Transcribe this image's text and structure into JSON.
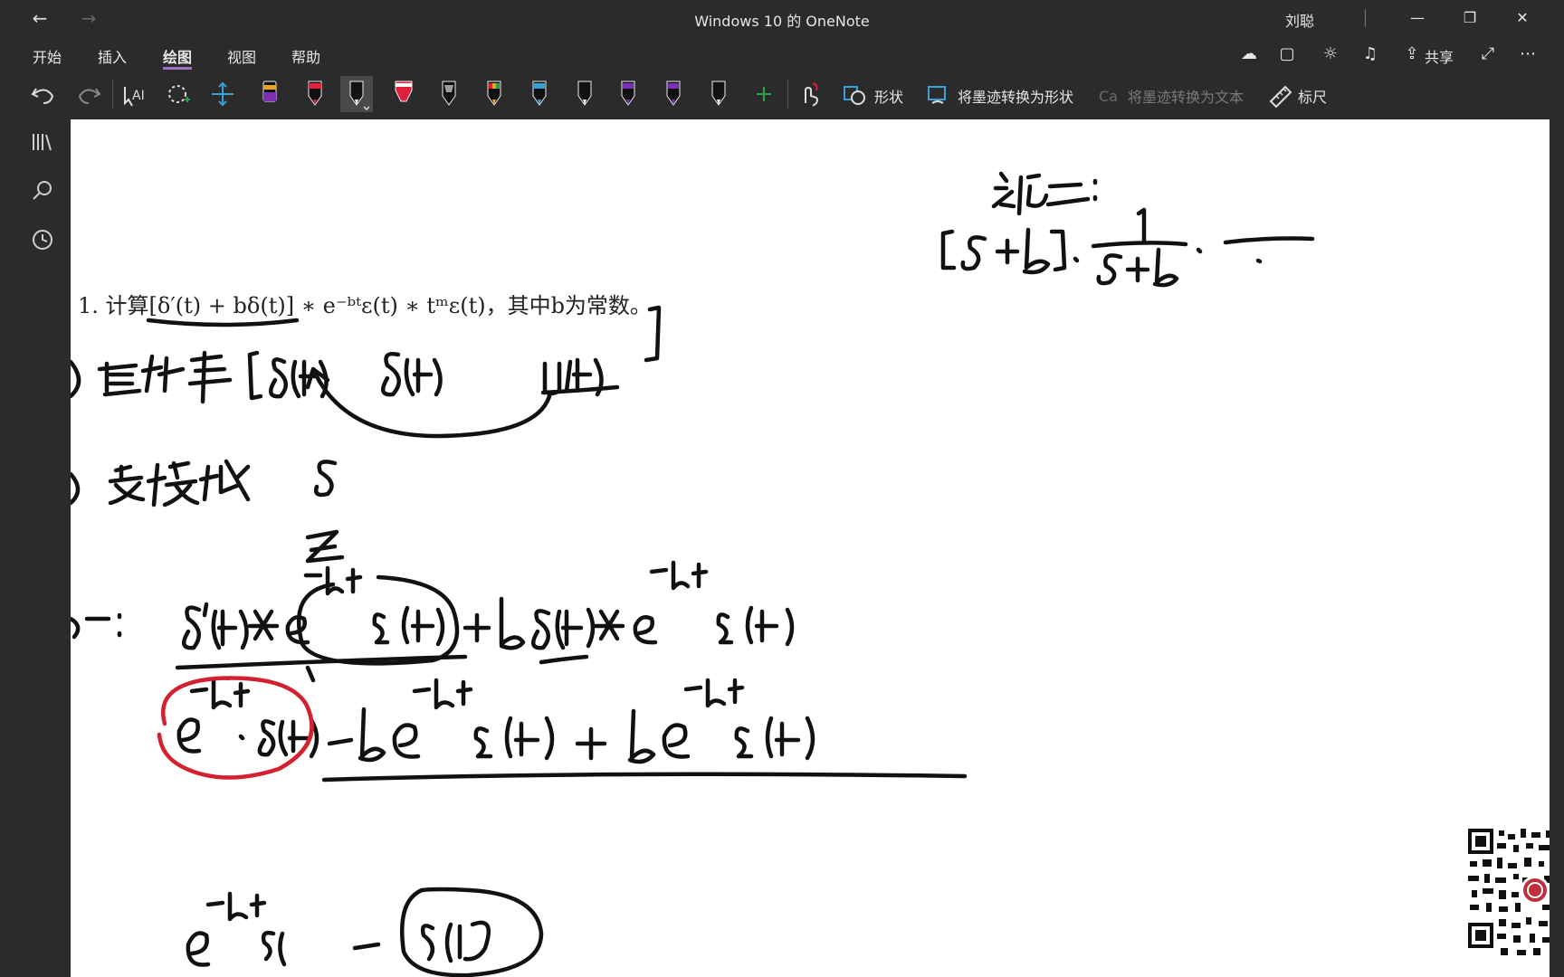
{
  "window": {
    "title": "Windows 10 的 OneNote",
    "user": "刘聪"
  },
  "menu": {
    "tabs": [
      {
        "label": "开始"
      },
      {
        "label": "插入"
      },
      {
        "label": "绘图"
      },
      {
        "label": "视图"
      },
      {
        "label": "帮助"
      }
    ],
    "active_tab": "绘图",
    "share_label": "共享"
  },
  "ribbon": {
    "shapes_label": "形状",
    "ink_to_shape_label": "将墨迹转换为形状",
    "ink_to_text_label": "将墨迹转换为文本",
    "ruler_label": "标尺",
    "pens": [
      {
        "color": "#7b2fb5"
      },
      {
        "color": "#e0203c"
      },
      {
        "color": "#000000"
      },
      {
        "color": "#e0203c"
      },
      {
        "color": "#9aa0a6"
      },
      {
        "color": "#e8a520"
      },
      {
        "color": "#3aa0d8"
      },
      {
        "color": "#000000"
      },
      {
        "color": "#7b2fb5"
      },
      {
        "color": "#7b2fb5"
      },
      {
        "color": "#000000"
      }
    ],
    "add_pen_color": "#2ea043"
  },
  "page": {
    "problem_text": "1. 计算[δ′(t) + bδ(t)] ∗ e⁻ᵇᵗε(t) ∗ tᵐε(t)，其中b为常数。"
  },
  "colors": {
    "accent": "#a074c4",
    "chrome": "#2b2b2b",
    "canvas": "#ffffff",
    "ink_red": "#d42030"
  }
}
